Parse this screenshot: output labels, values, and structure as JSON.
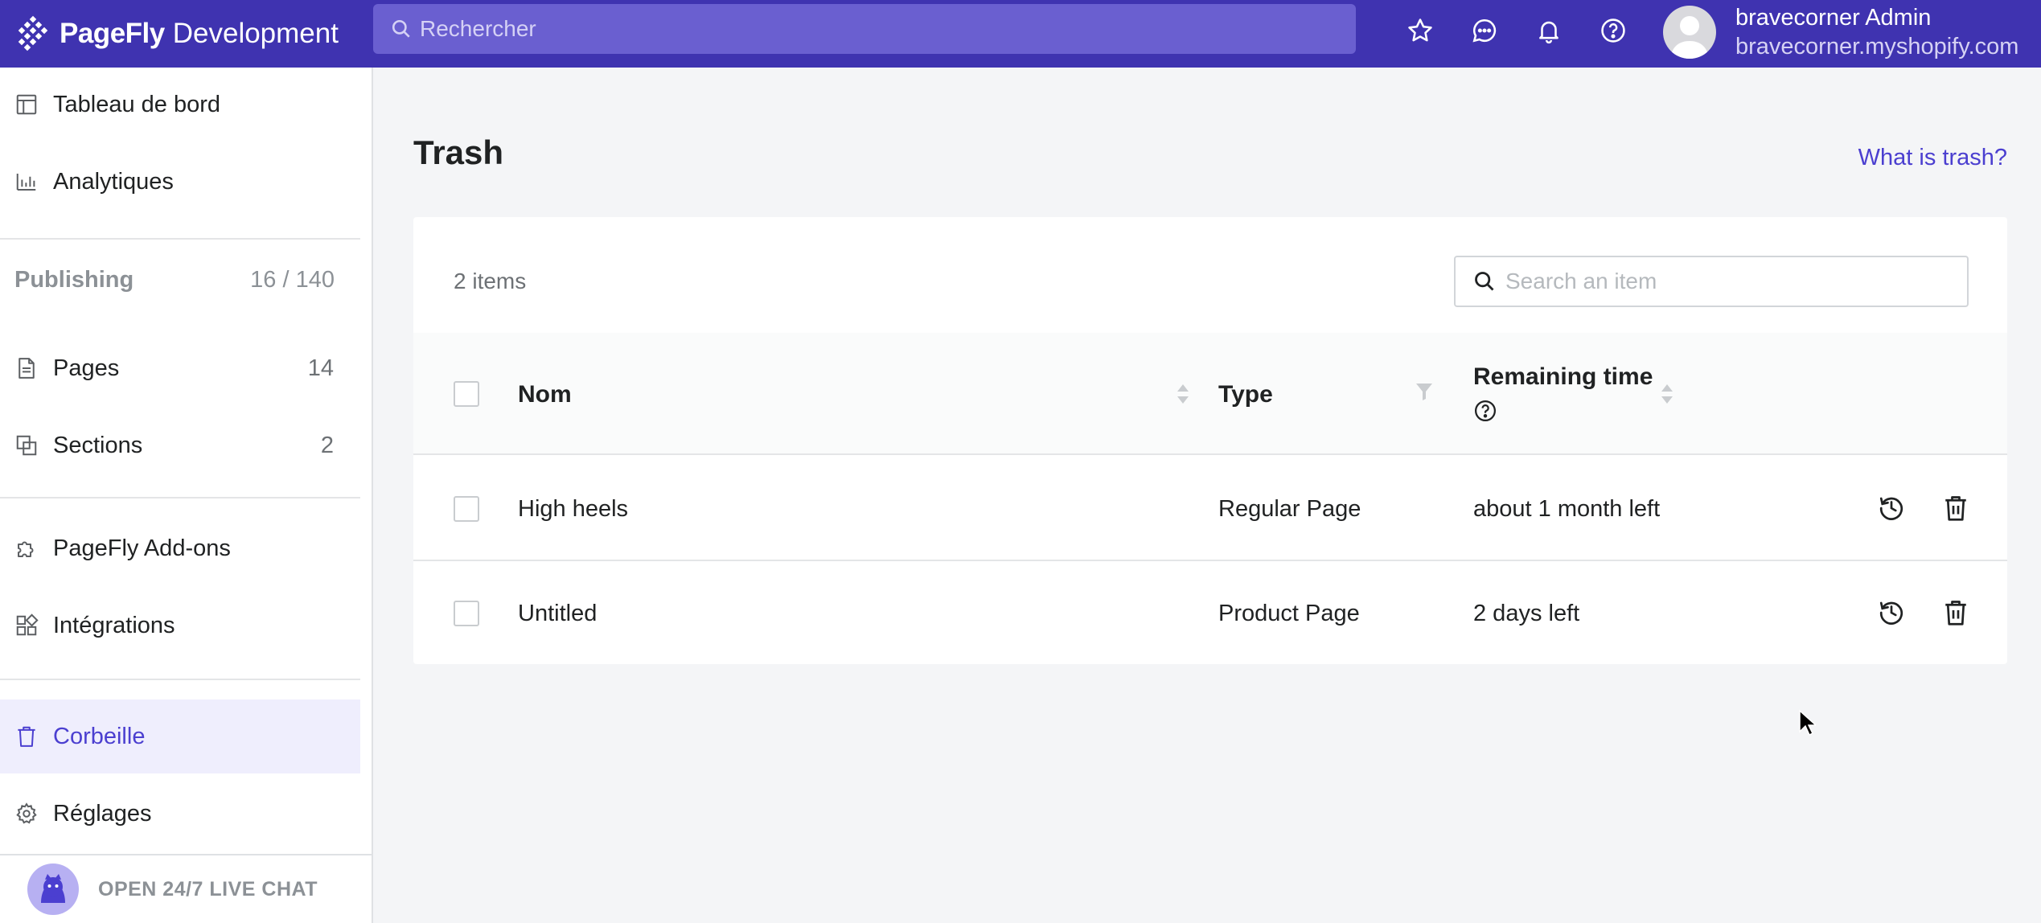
{
  "header": {
    "brand_name": "PageFly",
    "brand_env": "Development",
    "search_placeholder": "Rechercher",
    "user_name": "bravecorner Admin",
    "user_shop": "bravecorner.myshopify.com",
    "icons": [
      "star-icon",
      "chat-icon",
      "bell-icon",
      "help-icon"
    ]
  },
  "sidebar": {
    "items": [
      {
        "label": "Tableau de bord",
        "icon": "dashboard-icon"
      },
      {
        "label": "Analytiques",
        "icon": "analytics-icon"
      },
      {
        "label": "Pages",
        "count": "14",
        "icon": "page-icon"
      },
      {
        "label": "Sections",
        "count": "2",
        "icon": "sections-icon"
      },
      {
        "label": "PageFly Add-ons",
        "icon": "puzzle-icon"
      },
      {
        "label": "Intégrations",
        "icon": "integrations-icon"
      },
      {
        "label": "Corbeille",
        "icon": "trash-icon",
        "active": true
      },
      {
        "label": "Réglages",
        "icon": "settings-icon"
      }
    ],
    "publishing_title": "Publishing",
    "publishing_count": "16 / 140",
    "live_chat_label": "OPEN 24/7 LIVE CHAT"
  },
  "main": {
    "title": "Trash",
    "help_link": "What is trash?",
    "item_count": "2 items",
    "search_placeholder": "Search an item",
    "columns": {
      "name": "Nom",
      "type": "Type",
      "remaining": "Remaining time"
    },
    "rows": [
      {
        "name": "High heels",
        "type": "Regular Page",
        "remaining": "about 1 month left"
      },
      {
        "name": "Untitled",
        "type": "Product Page",
        "remaining": "2 days left"
      }
    ]
  },
  "colors": {
    "brand": "#3f33b0",
    "search_bg": "#6a5fd0",
    "accent": "#4b3fd0",
    "active_bg": "#efeefd",
    "page_bg": "#f4f5f7"
  }
}
